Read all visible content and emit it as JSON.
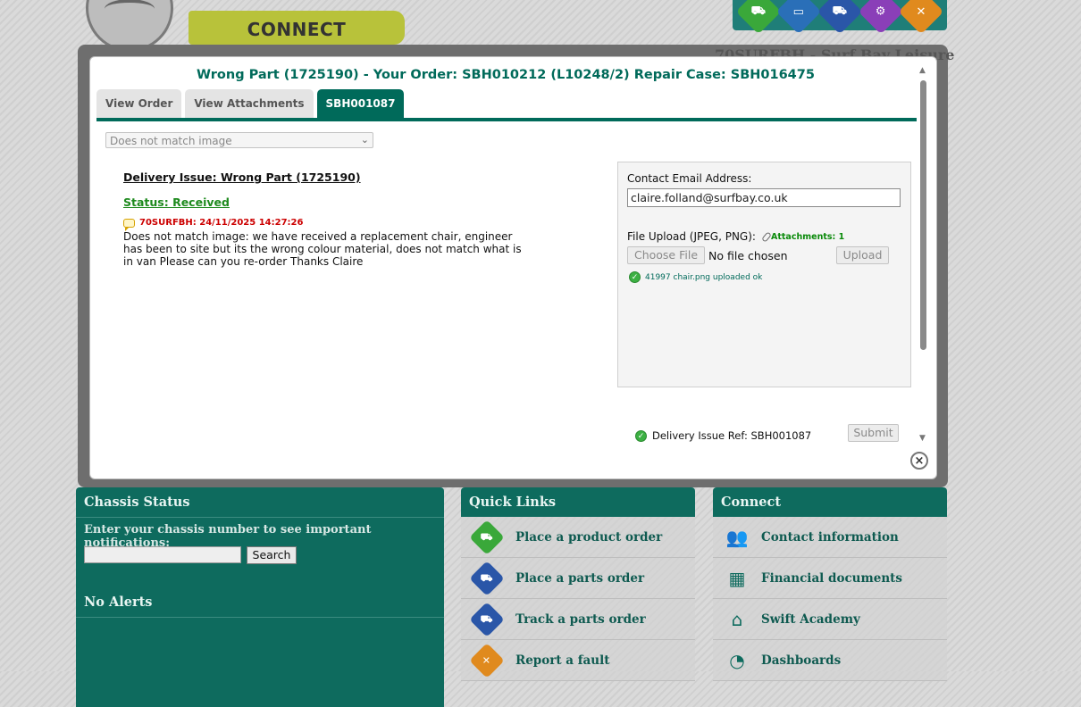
{
  "brand": {
    "logo_word": "CONNECT"
  },
  "dealer_title": "70SURFBH - Surf Bay Leisure",
  "top_icons": [
    {
      "icon": "caravan-icon",
      "color": "#3aa83a"
    },
    {
      "icon": "laptop-icon",
      "color": "#2a6fb8"
    },
    {
      "icon": "truck-icon",
      "color": "#2a56a8"
    },
    {
      "icon": "gears-icon",
      "color": "#8a3fb8"
    },
    {
      "icon": "tools-icon",
      "color": "#e08a1e"
    }
  ],
  "modal": {
    "title": "Wrong Part (1725190) - Your Order: SBH010212 (L10248/2) Repair Case: SBH016475",
    "tabs": [
      {
        "label": "View Order",
        "active": false
      },
      {
        "label": "View Attachments",
        "active": false
      },
      {
        "label": "SBH001087",
        "active": true
      }
    ],
    "reason_select": {
      "value": "Does not match image"
    },
    "issue_heading": "Delivery Issue: Wrong Part (1725190)",
    "status": "Status: Received",
    "note": {
      "meta": "70SURFBH: 24/11/2025 14:27:26",
      "text": "Does not match image: we have received a replacement chair, engineer has been to site but its the wrong colour material, does not match what is in van Please can you re-order Thanks Claire"
    },
    "contact": {
      "email_label": "Contact Email Address:",
      "email_value": "claire.folland@surfbay.co.uk",
      "upload_label": "File Upload (JPEG, PNG):",
      "attachments": "Attachments: 1",
      "choose_file": "Choose File",
      "no_file": "No file chosen",
      "upload_button": "Upload",
      "upload_status": "41997 chair.png uploaded ok"
    },
    "ref": "Delivery Issue Ref: SBH001087",
    "submit": "Submit"
  },
  "chassis": {
    "title": "Chassis Status",
    "prompt": "Enter your chassis number to see important notifications:",
    "input_value": "",
    "search_button": "Search"
  },
  "alerts": {
    "title": "No Alerts"
  },
  "quick_links": {
    "title": "Quick Links",
    "items": [
      {
        "label": "Place a product order",
        "icon": "caravan-icon",
        "color": "#3aa83a"
      },
      {
        "label": "Place a parts order",
        "icon": "truck-icon",
        "color": "#2a56a8"
      },
      {
        "label": "Track a parts order",
        "icon": "truck-icon",
        "color": "#2a56a8"
      },
      {
        "label": "Report a fault",
        "icon": "tools-icon",
        "color": "#e08a1e"
      }
    ]
  },
  "connect": {
    "title": "Connect",
    "items": [
      {
        "label": "Contact information",
        "icon": "people-icon"
      },
      {
        "label": "Financial documents",
        "icon": "calculator-icon"
      },
      {
        "label": "Swift Academy",
        "icon": "academy-icon"
      },
      {
        "label": "Dashboards",
        "icon": "gauge-icon"
      }
    ]
  }
}
